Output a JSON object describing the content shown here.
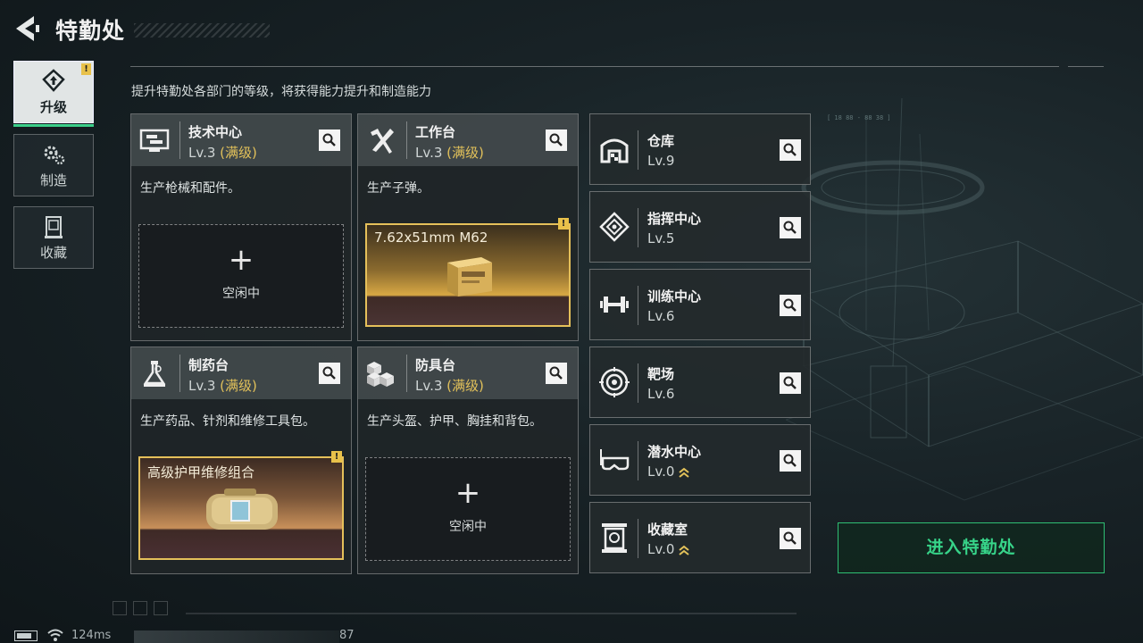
{
  "header": {
    "title": "特勤处"
  },
  "subtitle": "提升特勤处各部门的等级，将获得能力提升和制造能力",
  "sidebar": {
    "tabs": [
      {
        "label": "升级",
        "icon": "upgrade-icon",
        "active": true,
        "alert": "!"
      },
      {
        "label": "制造",
        "icon": "gears-icon",
        "active": false
      },
      {
        "label": "收藏",
        "icon": "collection-icon",
        "active": false
      }
    ]
  },
  "cards": [
    {
      "name": "技术中心",
      "level": "Lv.3",
      "max_label": "(满级)",
      "icon": "tech-center-icon",
      "desc": "生产枪械和配件。",
      "slot": {
        "state": "empty",
        "plus": "+",
        "label": "空闲中"
      }
    },
    {
      "name": "工作台",
      "level": "Lv.3",
      "max_label": "(满级)",
      "icon": "workbench-icon",
      "desc": "生产子弹。",
      "slot": {
        "state": "item",
        "item_name": "7.62x51mm M62",
        "alert": "!"
      }
    },
    {
      "name": "制药台",
      "level": "Lv.3",
      "max_label": "(满级)",
      "icon": "pharmacy-icon",
      "desc": "生产药品、针剂和维修工具包。",
      "slot": {
        "state": "item",
        "item_name": "高级护甲维修组合",
        "alert": "!"
      }
    },
    {
      "name": "防具台",
      "level": "Lv.3",
      "max_label": "(满级)",
      "icon": "armor-bench-icon",
      "desc": "生产头盔、护甲、胸挂和背包。",
      "slot": {
        "state": "empty",
        "plus": "+",
        "label": "空闲中"
      }
    }
  ],
  "right_cards": [
    {
      "name": "仓库",
      "level": "Lv.9",
      "icon": "warehouse-icon",
      "upgradable": false
    },
    {
      "name": "指挥中心",
      "level": "Lv.5",
      "icon": "command-center-icon",
      "upgradable": false
    },
    {
      "name": "训练中心",
      "level": "Lv.6",
      "icon": "training-center-icon",
      "upgradable": false
    },
    {
      "name": "靶场",
      "level": "Lv.6",
      "icon": "target-range-icon",
      "upgradable": false
    },
    {
      "name": "潜水中心",
      "level": "Lv.0",
      "icon": "diving-center-icon",
      "upgradable": true
    },
    {
      "name": "收藏室",
      "level": "Lv.0",
      "icon": "collection-room-icon",
      "upgradable": true
    }
  ],
  "enter_button": "进入特勤处",
  "status_bar": {
    "ping": "124ms",
    "fps": "87"
  },
  "colors": {
    "accent_green": "#37d489",
    "gold": "#e2c15a",
    "alert": "#e8c14a"
  }
}
